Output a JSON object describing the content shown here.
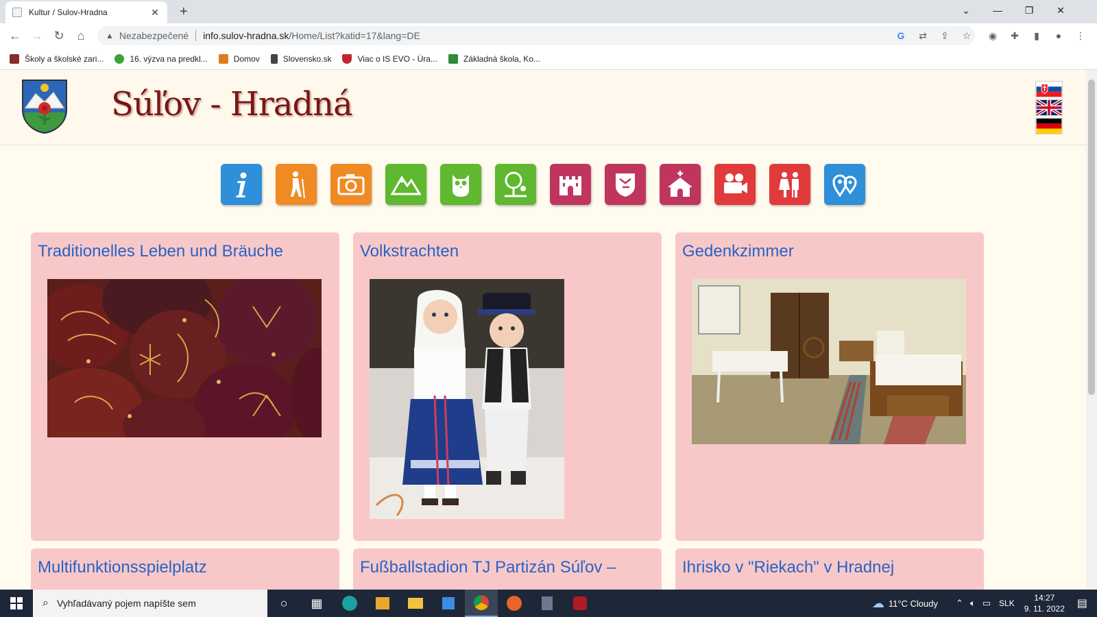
{
  "browser": {
    "tab_title": "Kultur / Sulov-Hradna",
    "tab_close": "✕",
    "new_tab": "+",
    "window_controls": [
      "⌄",
      "—",
      "❐",
      "✕"
    ],
    "security_label": "Nezabezpečené",
    "url_host": "info.sulov-hradna.sk",
    "url_path": "/Home/List?katid=17&lang=DE",
    "bookmarks": [
      {
        "label": "Školy a školské zari...",
        "color": "#8a2b2b"
      },
      {
        "label": "16. výzva na predkl...",
        "color": "#3aa23a"
      },
      {
        "label": "Domov",
        "color": "#e07a1f"
      },
      {
        "label": "Slovensko.sk",
        "color": "#444444"
      },
      {
        "label": "Viac o IS EVO - Úra...",
        "color": "#c0272d"
      },
      {
        "label": "Základná škola, Ko...",
        "color": "#2e8b3a"
      }
    ]
  },
  "site": {
    "title": "Súľov - Hradná",
    "flags": [
      "slovak-flag",
      "uk-flag",
      "german-flag"
    ]
  },
  "nav_icons": [
    {
      "name": "info",
      "color": "#2f8fd8"
    },
    {
      "name": "hiking",
      "color": "#f08a24"
    },
    {
      "name": "camera",
      "color": "#f08a24"
    },
    {
      "name": "mountains",
      "color": "#5fb82f"
    },
    {
      "name": "owl",
      "color": "#5fb82f"
    },
    {
      "name": "tree",
      "color": "#5fb82f"
    },
    {
      "name": "castle",
      "color": "#c0355e"
    },
    {
      "name": "map-heraldry",
      "color": "#c0355e"
    },
    {
      "name": "church",
      "color": "#c0355e"
    },
    {
      "name": "film-camera",
      "color": "#e03a3a"
    },
    {
      "name": "folk-couple",
      "color": "#e03a3a"
    },
    {
      "name": "map-pins",
      "color": "#2f8fd8"
    }
  ],
  "cards": [
    {
      "title": "Traditionelles Leben und Bräuche"
    },
    {
      "title": "Volkstrachten"
    },
    {
      "title": "Gedenkzimmer"
    },
    {
      "title": "Multifunktionsspielplatz"
    },
    {
      "title": "Fußballstadion TJ Partizán Súľov –"
    },
    {
      "title": "Ihrisko v \"Riekach\" v Hradnej"
    }
  ],
  "taskbar": {
    "search_placeholder": "Vyhľadávaný pojem napíšte sem",
    "weather": "11°C  Cloudy",
    "language": "SLK",
    "time": "14:27",
    "date": "9. 11. 2022"
  }
}
